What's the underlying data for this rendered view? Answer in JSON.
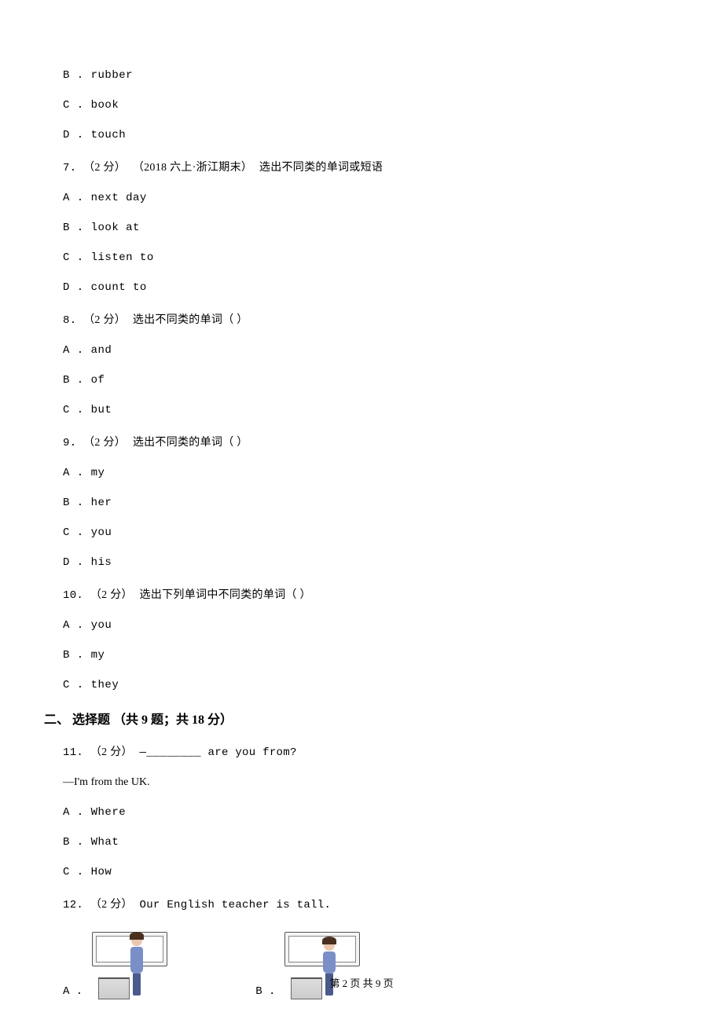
{
  "options_pre": [
    {
      "label": "B",
      "text": "rubber"
    },
    {
      "label": "C",
      "text": "book"
    },
    {
      "label": "D",
      "text": "touch"
    }
  ],
  "q7": {
    "num": "7.",
    "points": "（2 分）",
    "tag": "（2018 六上·浙江期末）",
    "stem": "选出不同类的单词或短语",
    "options": [
      {
        "label": "A",
        "text": "next day"
      },
      {
        "label": "B",
        "text": "look at"
      },
      {
        "label": "C",
        "text": "listen to"
      },
      {
        "label": "D",
        "text": "count to"
      }
    ]
  },
  "q8": {
    "num": "8.",
    "points": "（2 分）",
    "stem": "选出不同类的单词（    ）",
    "options": [
      {
        "label": "A",
        "text": "and"
      },
      {
        "label": "B",
        "text": "of"
      },
      {
        "label": "C",
        "text": "but"
      }
    ]
  },
  "q9": {
    "num": "9.",
    "points": "（2 分）",
    "stem": "选出不同类的单词（    ）",
    "options": [
      {
        "label": "A",
        "text": "my"
      },
      {
        "label": "B",
        "text": "her"
      },
      {
        "label": "C",
        "text": "you"
      },
      {
        "label": "D",
        "text": "his"
      }
    ]
  },
  "q10": {
    "num": "10.",
    "points": "（2 分）",
    "stem": "选出下列单词中不同类的单词（    ）",
    "options": [
      {
        "label": "A",
        "text": "you"
      },
      {
        "label": "B",
        "text": "my"
      },
      {
        "label": "C",
        "text": "they"
      }
    ]
  },
  "section2": "二、 选择题 （共 9 题；共 18 分）",
  "q11": {
    "num": "11.",
    "points": "（2 分）",
    "stem_pre": "—",
    "blank": "________",
    "stem_post": " are you from?",
    "answer": "—I'm from the UK.",
    "options": [
      {
        "label": "A",
        "text": "Where"
      },
      {
        "label": "B",
        "text": "What"
      },
      {
        "label": "C",
        "text": "How"
      }
    ]
  },
  "q12": {
    "num": "12.",
    "points": "（2 分）",
    "stem": "Our English teacher is tall.",
    "optA": "A .",
    "optB": "B ."
  },
  "footer": "第 2 页 共 9 页"
}
